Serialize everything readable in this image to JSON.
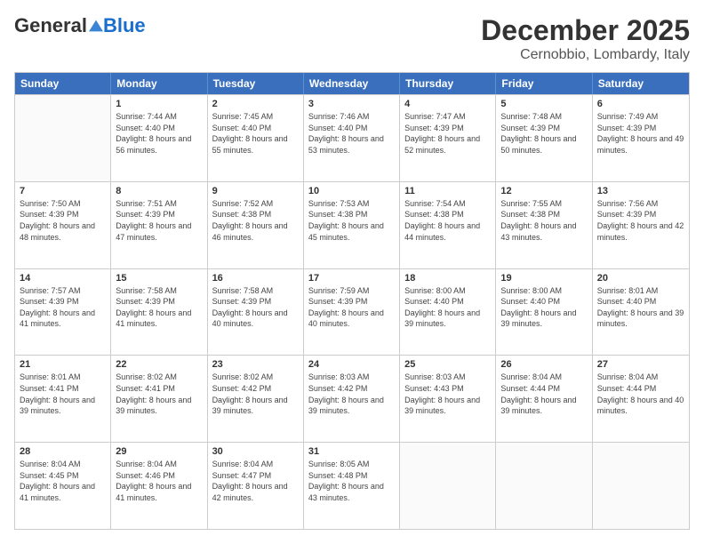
{
  "header": {
    "logo": {
      "general": "General",
      "blue": "Blue",
      "tagline": ""
    },
    "title": "December 2025",
    "location": "Cernobbio, Lombardy, Italy"
  },
  "calendar": {
    "weekdays": [
      "Sunday",
      "Monday",
      "Tuesday",
      "Wednesday",
      "Thursday",
      "Friday",
      "Saturday"
    ],
    "rows": [
      [
        {
          "day": "",
          "empty": true
        },
        {
          "day": "1",
          "sunrise": "7:44 AM",
          "sunset": "4:40 PM",
          "daylight": "8 hours and 56 minutes."
        },
        {
          "day": "2",
          "sunrise": "7:45 AM",
          "sunset": "4:40 PM",
          "daylight": "8 hours and 55 minutes."
        },
        {
          "day": "3",
          "sunrise": "7:46 AM",
          "sunset": "4:40 PM",
          "daylight": "8 hours and 53 minutes."
        },
        {
          "day": "4",
          "sunrise": "7:47 AM",
          "sunset": "4:39 PM",
          "daylight": "8 hours and 52 minutes."
        },
        {
          "day": "5",
          "sunrise": "7:48 AM",
          "sunset": "4:39 PM",
          "daylight": "8 hours and 50 minutes."
        },
        {
          "day": "6",
          "sunrise": "7:49 AM",
          "sunset": "4:39 PM",
          "daylight": "8 hours and 49 minutes."
        }
      ],
      [
        {
          "day": "7",
          "sunrise": "7:50 AM",
          "sunset": "4:39 PM",
          "daylight": "8 hours and 48 minutes."
        },
        {
          "day": "8",
          "sunrise": "7:51 AM",
          "sunset": "4:39 PM",
          "daylight": "8 hours and 47 minutes."
        },
        {
          "day": "9",
          "sunrise": "7:52 AM",
          "sunset": "4:38 PM",
          "daylight": "8 hours and 46 minutes."
        },
        {
          "day": "10",
          "sunrise": "7:53 AM",
          "sunset": "4:38 PM",
          "daylight": "8 hours and 45 minutes."
        },
        {
          "day": "11",
          "sunrise": "7:54 AM",
          "sunset": "4:38 PM",
          "daylight": "8 hours and 44 minutes."
        },
        {
          "day": "12",
          "sunrise": "7:55 AM",
          "sunset": "4:38 PM",
          "daylight": "8 hours and 43 minutes."
        },
        {
          "day": "13",
          "sunrise": "7:56 AM",
          "sunset": "4:39 PM",
          "daylight": "8 hours and 42 minutes."
        }
      ],
      [
        {
          "day": "14",
          "sunrise": "7:57 AM",
          "sunset": "4:39 PM",
          "daylight": "8 hours and 41 minutes."
        },
        {
          "day": "15",
          "sunrise": "7:58 AM",
          "sunset": "4:39 PM",
          "daylight": "8 hours and 41 minutes."
        },
        {
          "day": "16",
          "sunrise": "7:58 AM",
          "sunset": "4:39 PM",
          "daylight": "8 hours and 40 minutes."
        },
        {
          "day": "17",
          "sunrise": "7:59 AM",
          "sunset": "4:39 PM",
          "daylight": "8 hours and 40 minutes."
        },
        {
          "day": "18",
          "sunrise": "8:00 AM",
          "sunset": "4:40 PM",
          "daylight": "8 hours and 39 minutes."
        },
        {
          "day": "19",
          "sunrise": "8:00 AM",
          "sunset": "4:40 PM",
          "daylight": "8 hours and 39 minutes."
        },
        {
          "day": "20",
          "sunrise": "8:01 AM",
          "sunset": "4:40 PM",
          "daylight": "8 hours and 39 minutes."
        }
      ],
      [
        {
          "day": "21",
          "sunrise": "8:01 AM",
          "sunset": "4:41 PM",
          "daylight": "8 hours and 39 minutes."
        },
        {
          "day": "22",
          "sunrise": "8:02 AM",
          "sunset": "4:41 PM",
          "daylight": "8 hours and 39 minutes."
        },
        {
          "day": "23",
          "sunrise": "8:02 AM",
          "sunset": "4:42 PM",
          "daylight": "8 hours and 39 minutes."
        },
        {
          "day": "24",
          "sunrise": "8:03 AM",
          "sunset": "4:42 PM",
          "daylight": "8 hours and 39 minutes."
        },
        {
          "day": "25",
          "sunrise": "8:03 AM",
          "sunset": "4:43 PM",
          "daylight": "8 hours and 39 minutes."
        },
        {
          "day": "26",
          "sunrise": "8:04 AM",
          "sunset": "4:44 PM",
          "daylight": "8 hours and 39 minutes."
        },
        {
          "day": "27",
          "sunrise": "8:04 AM",
          "sunset": "4:44 PM",
          "daylight": "8 hours and 40 minutes."
        }
      ],
      [
        {
          "day": "28",
          "sunrise": "8:04 AM",
          "sunset": "4:45 PM",
          "daylight": "8 hours and 41 minutes."
        },
        {
          "day": "29",
          "sunrise": "8:04 AM",
          "sunset": "4:46 PM",
          "daylight": "8 hours and 41 minutes."
        },
        {
          "day": "30",
          "sunrise": "8:04 AM",
          "sunset": "4:47 PM",
          "daylight": "8 hours and 42 minutes."
        },
        {
          "day": "31",
          "sunrise": "8:05 AM",
          "sunset": "4:48 PM",
          "daylight": "8 hours and 43 minutes."
        },
        {
          "day": "",
          "empty": true
        },
        {
          "day": "",
          "empty": true
        },
        {
          "day": "",
          "empty": true
        }
      ]
    ]
  }
}
